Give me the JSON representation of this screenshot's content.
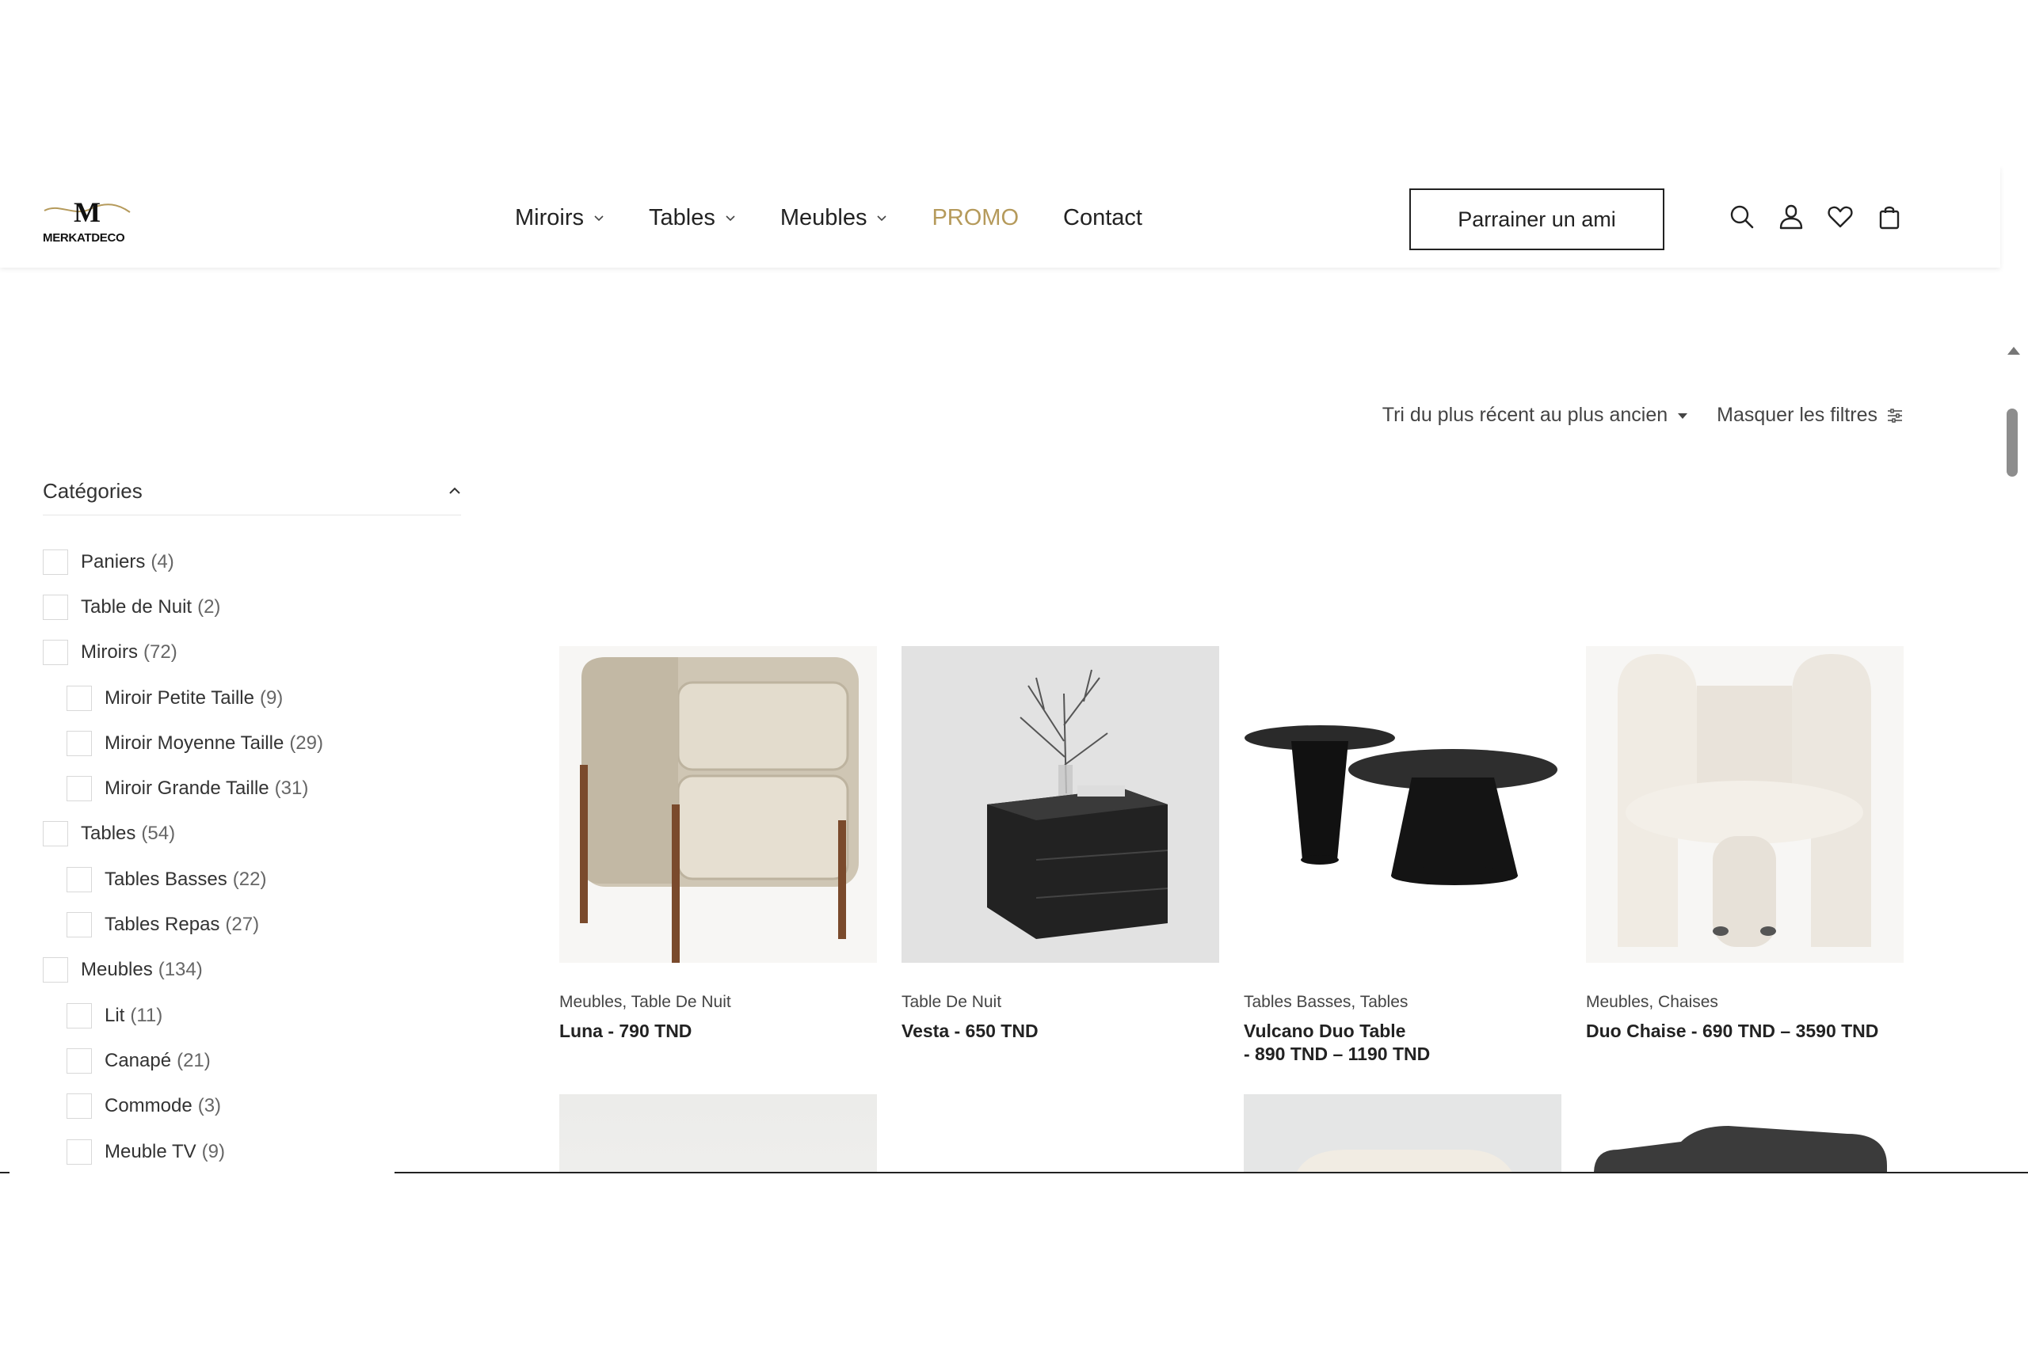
{
  "brand": {
    "name": "MERKATDECO",
    "initial": "M"
  },
  "nav": {
    "items": [
      {
        "label": "Miroirs",
        "dropdown": true
      },
      {
        "label": "Tables",
        "dropdown": true
      },
      {
        "label": "Meubles",
        "dropdown": true
      },
      {
        "label": "PROMO",
        "dropdown": false
      },
      {
        "label": "Contact",
        "dropdown": false
      }
    ],
    "refer_button": "Parrainer un ami",
    "icons": [
      "search-icon",
      "user-icon",
      "heart-icon",
      "bag-icon"
    ]
  },
  "toolbar": {
    "sort_label": "Tri du plus récent au plus ancien",
    "filters_label": "Masquer les filtres"
  },
  "sidebar": {
    "heading": "Catégories",
    "categories": [
      {
        "label": "Paniers",
        "count": "(4)",
        "level": 0
      },
      {
        "label": "Table de Nuit",
        "count": "(2)",
        "level": 0
      },
      {
        "label": "Miroirs",
        "count": "(72)",
        "level": 0
      },
      {
        "label": "Miroir Petite Taille",
        "count": "(9)",
        "level": 1
      },
      {
        "label": "Miroir Moyenne Taille",
        "count": "(29)",
        "level": 1
      },
      {
        "label": "Miroir Grande Taille",
        "count": "(31)",
        "level": 1
      },
      {
        "label": "Tables",
        "count": "(54)",
        "level": 0
      },
      {
        "label": "Tables Basses",
        "count": "(22)",
        "level": 1
      },
      {
        "label": "Tables Repas",
        "count": "(27)",
        "level": 1
      },
      {
        "label": "Meubles",
        "count": "(134)",
        "level": 0
      },
      {
        "label": "Lit",
        "count": "(11)",
        "level": 1
      },
      {
        "label": "Canapé",
        "count": "(21)",
        "level": 1
      },
      {
        "label": "Commode",
        "count": "(3)",
        "level": 1
      },
      {
        "label": "Meuble TV",
        "count": "(9)",
        "level": 1
      }
    ]
  },
  "products": [
    {
      "categories": "Meubles, Table De Nuit",
      "title": "Luna - 790 TND",
      "image": "nightstand"
    },
    {
      "categories": "Table De Nuit",
      "title": "Vesta - 650 TND",
      "image": "black-chest"
    },
    {
      "categories": "Tables Basses, Tables",
      "title": "Vulcano Duo Table\n - 890 TND – 1190 TND",
      "image": "coffee-tables"
    },
    {
      "categories": "Meubles, Chaises",
      "title": "Duo Chaise - 690 TND – 3590 TND",
      "image": "boucle-chair"
    },
    {
      "categories": "",
      "title": "",
      "image": "beige-sofa"
    },
    {
      "categories": "",
      "title": "",
      "image": "chesterfield-sofa"
    },
    {
      "categories": "",
      "title": "",
      "image": "armchair"
    },
    {
      "categories": "",
      "title": "",
      "image": "sectional-sofa"
    }
  ],
  "colors": {
    "promo": "#b59a5b",
    "text": "#222222"
  }
}
